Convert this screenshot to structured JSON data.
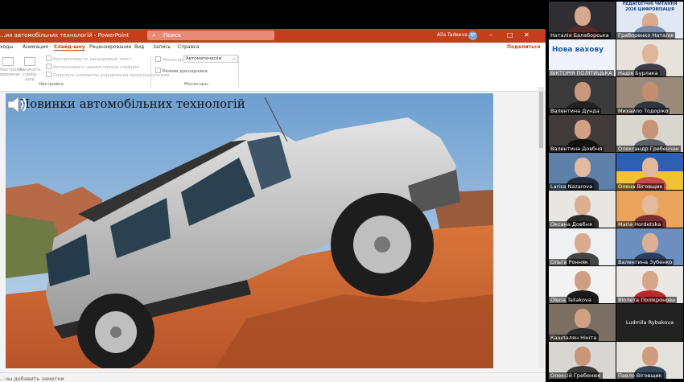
{
  "powerpoint": {
    "window_title": "...ия автомобільних технологій - PowerPoint",
    "search_placeholder": "Поиск",
    "user_name": "Alla Tadeeva",
    "user_initials": "AT",
    "window_buttons": [
      "–",
      "□",
      "✕"
    ],
    "tabs": [
      "ходы",
      "Анимация",
      "Слайд-шоу",
      "Рецензирование",
      "Вид",
      "Запись",
      "Справка"
    ],
    "active_tab": "Слайд-шоу",
    "share_label": "Поделиться",
    "ribbon": {
      "rehearse_label": "Настройка времени",
      "record_label": "Записать слайд-шоу",
      "checkboxes": [
        "Воспроизвести закадровый текст",
        "Использовать время показа слайдов",
        "Показать элементы управления проигрывателем"
      ],
      "group_setup": "Настройка",
      "monitor_label": "Монитор:",
      "monitor_value": "Автоматически",
      "presenter_view": "Режим докладчика",
      "group_monitors": "Мониторы"
    },
    "slide": {
      "title": "Новинки автомобільних технологій"
    },
    "notes_placeholder": "...чы добавить заметки"
  },
  "participants": [
    {
      "name": "Наталія Балаборська"
    },
    {
      "name": "Граборенко Наталія",
      "banner": "ПЕДАГОГІЧНІ ЧИТАННЯ 2026 ЦИФРОВІЗАЦІЯ"
    },
    {
      "name": "ВІКТОРІЯ ПОЛІТИЦЬКА",
      "logo_text": "Нова вахову"
    },
    {
      "name": "Надія Бурлака"
    },
    {
      "name": "Валентина Дунда"
    },
    {
      "name": "Михайло Тодоріко"
    },
    {
      "name": "Валентина Довбня"
    },
    {
      "name": "Олександр Гребенчак"
    },
    {
      "name": "Larisa Nazarova"
    },
    {
      "name": "Олена Віговщик"
    },
    {
      "name": "Оксана Довбня"
    },
    {
      "name": "Maria Hordetska"
    },
    {
      "name": "Ольга Ронняк"
    },
    {
      "name": "Валентина Зубенко"
    },
    {
      "name": "Olena Tailakova"
    },
    {
      "name": "Віолета Полікронова"
    },
    {
      "name": "Кашпалян Нікіта"
    },
    {
      "name": "Ludmila Rybakova"
    },
    {
      "name": "Олексій Гребенюк"
    },
    {
      "name": "Павло Віговщик"
    }
  ],
  "colors": {
    "ppt_accent": "#c43e1c",
    "ribbon_bg": "#ffffff",
    "window_bg": "#f3f3f3",
    "grid_bg": "#000000"
  }
}
